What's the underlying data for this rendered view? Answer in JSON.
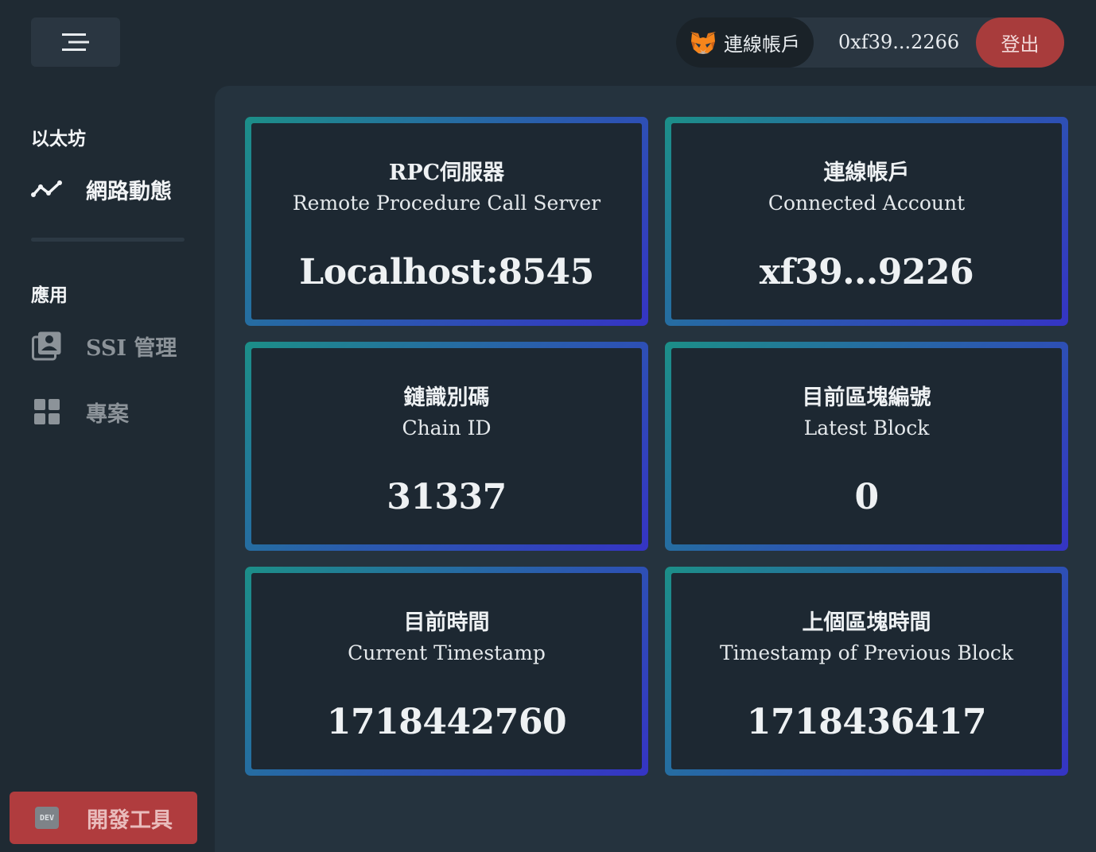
{
  "header": {
    "connect_label": "連線帳戶",
    "address": "0xf39...2266",
    "logout_label": "登出"
  },
  "sidebar": {
    "sections": [
      {
        "title": "以太坊",
        "items": [
          {
            "label": "網路動態",
            "icon": "activity-line-icon",
            "active": true
          }
        ]
      },
      {
        "title": "應用",
        "items": [
          {
            "label": "SSI 管理",
            "icon": "id-card-icon",
            "active": false
          },
          {
            "label": "專案",
            "icon": "grid-icon",
            "active": false
          }
        ]
      }
    ],
    "dev_tools": {
      "badge": "DEV",
      "label": "開發工具"
    }
  },
  "cards": [
    {
      "title": "RPC伺服器",
      "subtitle": "Remote Procedure Call Server",
      "value": "Localhost:8545"
    },
    {
      "title": "連線帳戶",
      "subtitle": "Connected Account",
      "value": "xf39...9226"
    },
    {
      "title": "鏈識別碼",
      "subtitle": "Chain ID",
      "value": "31337"
    },
    {
      "title": "目前區塊編號",
      "subtitle": "Latest Block",
      "value": "0"
    },
    {
      "title": "目前時間",
      "subtitle": "Current Timestamp",
      "value": "1718442760"
    },
    {
      "title": "上個區塊時間",
      "subtitle": "Timestamp of Previous Block",
      "value": "1718436417"
    }
  ],
  "colors": {
    "background": "#1f2a33",
    "panel": "#25333e",
    "logout": "#a83c3c",
    "dev_button": "#b03c3e",
    "card_gradient_start": "#1c8f88",
    "card_gradient_end": "#3534c4"
  }
}
